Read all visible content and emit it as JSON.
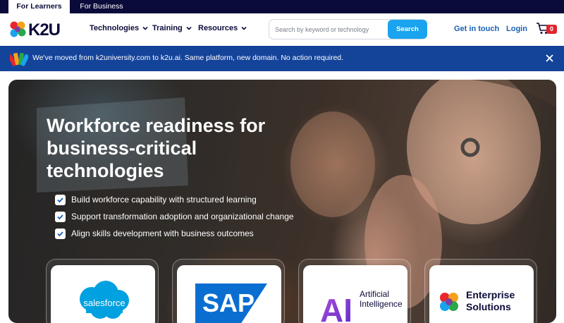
{
  "audience_tabs": [
    {
      "label": "For Learners",
      "active": true
    },
    {
      "label": "For Business",
      "active": false
    }
  ],
  "brand": {
    "logo_text": "K2U"
  },
  "nav": {
    "items": [
      {
        "label": "Technologies"
      },
      {
        "label": "Training"
      },
      {
        "label": "Resources"
      }
    ]
  },
  "search": {
    "placeholder": "Search by keyword or technology",
    "value": "",
    "button_label": "Search"
  },
  "header_links": {
    "contact": "Get in touch",
    "login": "Login"
  },
  "cart": {
    "count": "0"
  },
  "notice": {
    "text": "We've moved from k2university.com to k2u.ai. Same platform, new domain. No action required."
  },
  "hero": {
    "title": "Workforce readiness for business-critical technologies",
    "checklist": [
      "Build workforce capability with structured learning",
      "Support transformation adoption and organizational change",
      "Align skills development with business outcomes"
    ]
  },
  "tech_cards": [
    {
      "name": "salesforce"
    },
    {
      "name": "SAP"
    },
    {
      "name": "Artificial Intelligence",
      "mark": "AI"
    },
    {
      "name": "Enterprise Solutions"
    }
  ],
  "colors": {
    "navy": "#0b0b3b",
    "link_blue": "#1a5fb4",
    "search_blue": "#1aa3ee",
    "notice_blue": "#14439a",
    "cart_red": "#e0232a",
    "salesforce_blue": "#00a1e0",
    "sap_blue": "#0a6ed1"
  }
}
